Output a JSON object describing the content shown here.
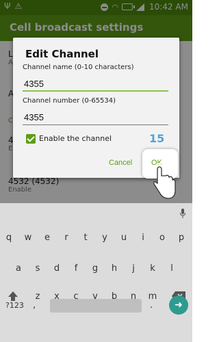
{
  "status": {
    "time": "10:42 AM"
  },
  "appbar": {
    "title": "Cell broadcast settings"
  },
  "list": {
    "item1_title": "L",
    "item1_sub": "A",
    "item2_title": "A",
    "category": "C",
    "item3_title": "4",
    "item3_sub": "E",
    "item4_title": "4532 (4532)",
    "item4_sub": "Enable"
  },
  "dialog": {
    "title": "Edit Channel",
    "name_label": "Channel name (0-10 characters)",
    "name_value": "4355",
    "number_label": "Channel number (0-65534)",
    "number_value": "4355",
    "enable_label": "Enable the channel",
    "enable_checked": true,
    "step_badge": "15",
    "cancel_label": "Cancel",
    "ok_label": "OK"
  },
  "keyboard": {
    "row1": [
      "q",
      "w",
      "e",
      "r",
      "t",
      "y",
      "u",
      "i",
      "o",
      "p"
    ],
    "row2": [
      "a",
      "s",
      "d",
      "f",
      "g",
      "h",
      "j",
      "k",
      "l"
    ],
    "row3": [
      "z",
      "x",
      "c",
      "v",
      "b",
      "n",
      "m"
    ],
    "symbols_label": "?123",
    "comma": ",",
    "period": "."
  }
}
